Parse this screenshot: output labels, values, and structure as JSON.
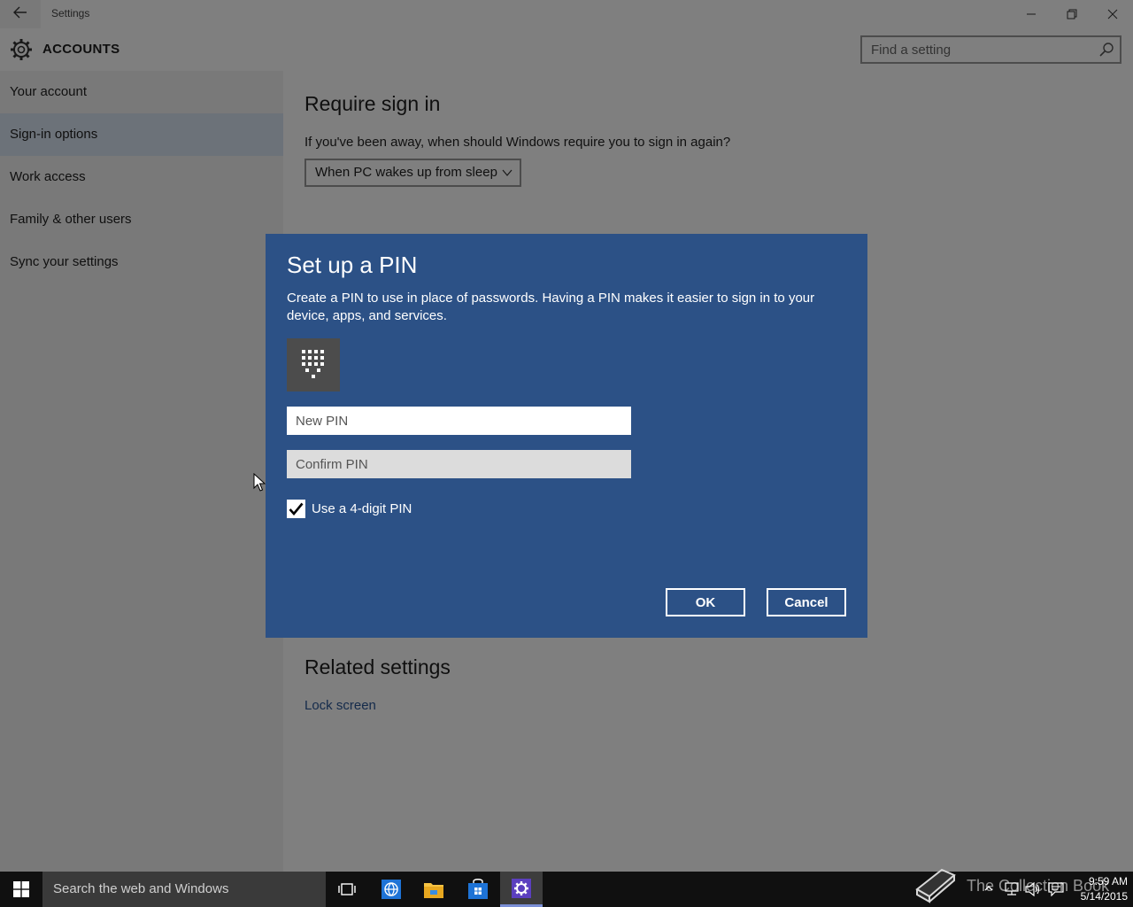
{
  "window": {
    "title": "Settings",
    "back_icon": "back-arrow-icon",
    "minimize_icon": "minimize-icon",
    "restore_icon": "restore-icon",
    "close_icon": "close-icon"
  },
  "header": {
    "title": "ACCOUNTS",
    "icon": "gear-icon"
  },
  "search": {
    "placeholder": "Find a setting",
    "icon": "search-icon"
  },
  "sidebar": {
    "items": [
      {
        "label": "Your account",
        "selected": false
      },
      {
        "label": "Sign-in options",
        "selected": true
      },
      {
        "label": "Work access",
        "selected": false
      },
      {
        "label": "Family & other users",
        "selected": false
      },
      {
        "label": "Sync your settings",
        "selected": false
      }
    ]
  },
  "main": {
    "require_heading": "Require sign in",
    "require_question": "If you've been away, when should Windows require you to sign in again?",
    "require_dropdown": "When PC wakes up from sleep",
    "related_heading": "Related settings",
    "lock_link": "Lock screen"
  },
  "dialog": {
    "title": "Set up a PIN",
    "description": "Create a PIN to use in place of passwords. Having a PIN makes it easier to sign in to your device, apps, and services.",
    "keypad_icon": "keypad-icon",
    "new_pin_placeholder": "New PIN",
    "confirm_pin_placeholder": "Confirm PIN",
    "checkbox_label": "Use a 4-digit PIN",
    "checkbox_checked": true,
    "ok_label": "OK",
    "cancel_label": "Cancel",
    "background_color": "#2c5186"
  },
  "taskbar": {
    "search_text": "Search the web and Windows",
    "time": "9:59 AM",
    "date": "5/14/2015",
    "watermark": "The Collection Book",
    "pinned": [
      "task-view-icon",
      "ie-icon",
      "file-explorer-icon",
      "store-icon",
      "settings-icon"
    ]
  }
}
